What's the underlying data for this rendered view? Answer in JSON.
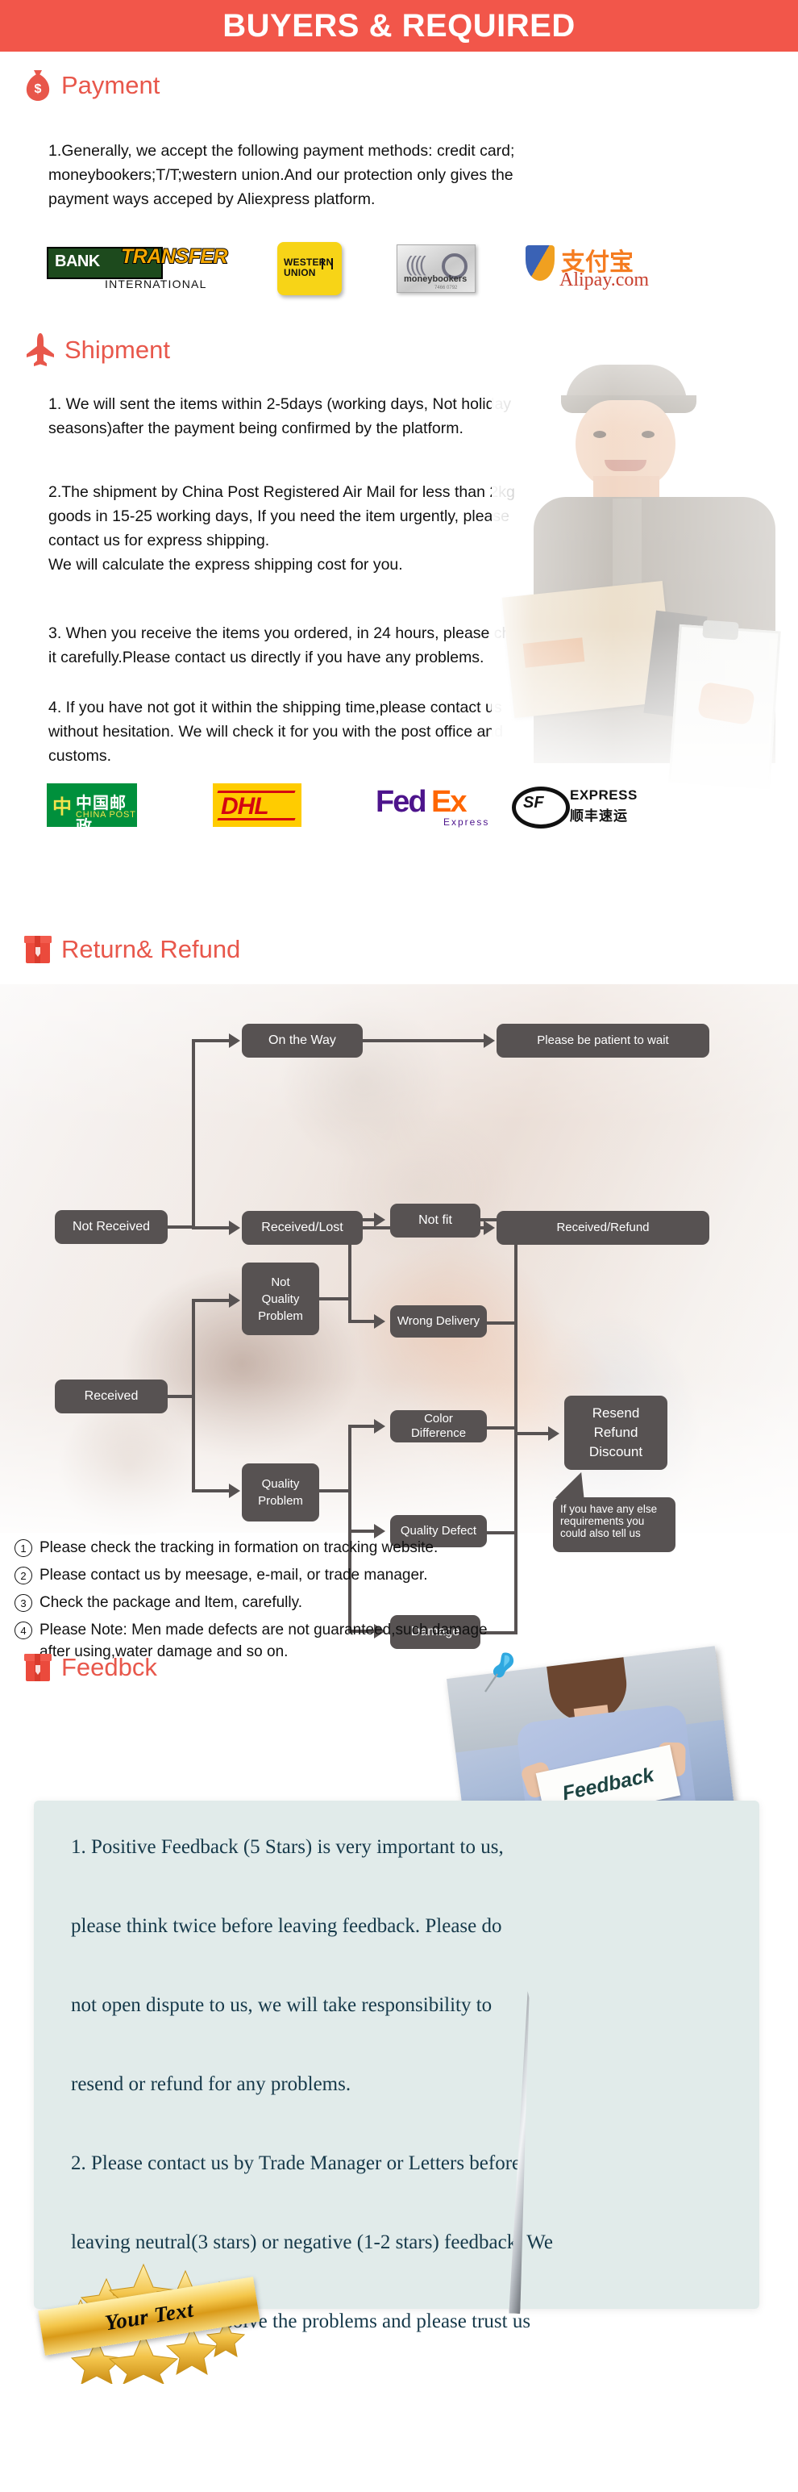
{
  "header": {
    "title": "BUYERS & REQUIRED",
    "bg_color": "#F2564A",
    "text_color": "#FFFFFF"
  },
  "theme": {
    "accent": "#E8574B",
    "node_gray": "#575252",
    "feedback_panel": "#E1EBEA",
    "feedback_text": "#16394A"
  },
  "sections": {
    "payment": {
      "icon": "money-bag-icon",
      "title": "Payment",
      "body": "1.Generally, we accept the following payment methods: credit card;\nmoneybookers;T/T;western union.And our protection only gives the\npayment ways acceped by Aliexpress platform.",
      "logos": [
        {
          "name": "bank-transfer-logo",
          "word": "BANK",
          "script": "TRANSFER",
          "sub": "INTERNATIONAL"
        },
        {
          "name": "western-union-logo",
          "line1": "WESTERN",
          "line2": "UNION"
        },
        {
          "name": "moneybookers-logo",
          "label": "moneybookers",
          "number": "7466 0792"
        },
        {
          "name": "alipay-logo",
          "cn": "支付宝",
          "en": "Alipay.com"
        }
      ]
    },
    "shipment": {
      "icon": "airplane-icon",
      "title": "Shipment",
      "p1": "1. We will sent the items within 2-5days (working days, Not holiday\nseasons)after the payment being confirmed by the platform.",
      "p2": "2.The shipment by China Post Registered Air Mail for less than  2kg\ngoods in 15-25 working days, If  you need the item urgently, please\ncontact us for express shipping.\nWe will calculate the express shipping cost for you.",
      "p3": "3. When you receive the items you ordered, in 24 hours, please check\n it carefully.Please contact us directly if you have any problems.",
      "p4": "4. If you have not got it within the shipping time,please contact us\nwithout hesitation. We will check it for you with the post office and\ncustoms.",
      "logos": [
        {
          "name": "china-post-logo",
          "symbol": "中",
          "cn": "中国邮政",
          "en": "CHINA POST"
        },
        {
          "name": "dhl-logo",
          "text": "DHL"
        },
        {
          "name": "fedex-logo",
          "part1": "Fed",
          "part2": "Ex",
          "sub": "Express"
        },
        {
          "name": "sf-express-logo",
          "mark": "SF",
          "en": "EXPRESS",
          "cn": "顺丰速运"
        }
      ]
    },
    "return_refund": {
      "icon": "gift-box-icon",
      "title": "Return& Refund",
      "flow_nodes": [
        {
          "id": "not-received",
          "label": "Not Received"
        },
        {
          "id": "on-the-way",
          "label": "On the Way"
        },
        {
          "id": "please-wait",
          "label": "Please be patient to wait"
        },
        {
          "id": "received-lost",
          "label": "Received/Lost"
        },
        {
          "id": "received-refund",
          "label": "Received/Refund"
        },
        {
          "id": "received",
          "label": "Received"
        },
        {
          "id": "not-quality-problem",
          "label": "Not\nQuality\nProblem"
        },
        {
          "id": "quality-problem",
          "label": "Quality\nProblem"
        },
        {
          "id": "not-fit",
          "label": "Not fit"
        },
        {
          "id": "wrong-delivery",
          "label": "Wrong Delivery"
        },
        {
          "id": "color-difference",
          "label": "Color Difference"
        },
        {
          "id": "quality-defect",
          "label": "Quality Defect"
        },
        {
          "id": "damage",
          "label": "Damage"
        },
        {
          "id": "resend-refund-discount",
          "label": "Resend\nRefund\nDiscount"
        }
      ],
      "callout": "If you have any else\nrequirements you\ncould also tell us",
      "notes": [
        {
          "marker": "①",
          "text": "Please check the tracking in formation on tracking website."
        },
        {
          "marker": "②",
          "text": "Please contact us by meesage, e-mail, or trade manager."
        },
        {
          "marker": "③",
          "text": "Check the package and ltem, carefully."
        },
        {
          "marker": "④",
          "text": "Please Note: Men made defects  are not guaranteed,such damage\n    after using,water damage and so on."
        }
      ]
    },
    "feedback": {
      "icon": "gift-box-icon",
      "title": "Feedbck",
      "photo_caption": "Feedback",
      "body": "1. Positive Feedback (5 Stars) is very important to us,\n\nplease think twice before leaving feedback. Please do\n\nnot open dispute to us,   we will take responsibility to\n\nresend or refund for any problems.\n\n2. Please contact us by Trade Manager or Letters before\n\nleaving neutral(3 stars) or negative (1-2 stars) feedback. We\n\nwill try our best to solve the problems and please trust us",
      "badge_text": "Your Text"
    }
  }
}
